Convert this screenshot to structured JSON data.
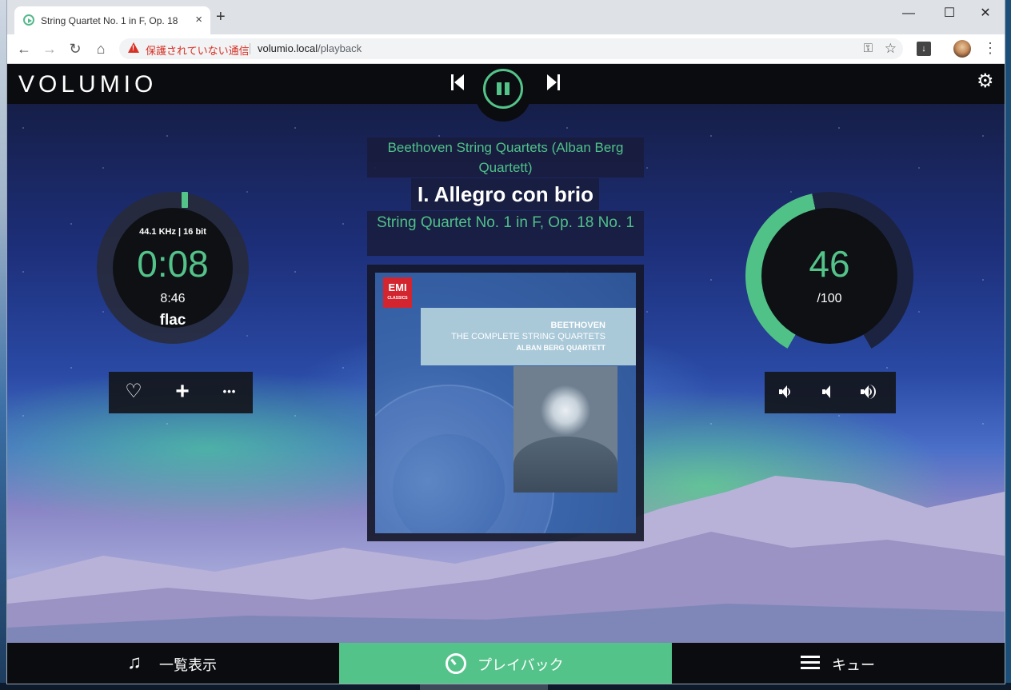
{
  "browser": {
    "tab_title": "String Quartet No. 1 in F, Op. 18",
    "tab_close": "×",
    "new_tab": "+",
    "window_controls": {
      "minimize": "—",
      "maximize": "☐",
      "close": "✕"
    },
    "security_text": "保護されていない通信",
    "url_host": "volumio.local",
    "url_path": "/playback",
    "nav": {
      "back": "←",
      "forward": "→",
      "reload": "↻",
      "home": "⌂"
    },
    "icons": {
      "key": "⚿",
      "star": "☆",
      "menu": "⋮",
      "extension": "↓"
    }
  },
  "app": {
    "logo": "VOLUMIO",
    "settings_icon": "⚙",
    "playback": {
      "sample_rate": "44.1 KHz | 16 bit",
      "elapsed": "0:08",
      "duration": "8:46",
      "format": "flac",
      "progress": 0.015
    },
    "actions": {
      "favorite": "♡",
      "add": "+",
      "more": "•••"
    },
    "album": "Beethoven String Quartets (Alban Berg Quartett)",
    "title": "I. Allegro con brio",
    "track": "String Quartet No. 1 in F, Op. 18 No. 1",
    "album_art": {
      "label_logo": "EMI",
      "label_sub": "CLASSICS",
      "line1": "BEETHOVEN",
      "line2": "THE COMPLETE STRING QUARTETS",
      "line3": "ALBAN BERG QUARTETT"
    },
    "volume": {
      "value": "46",
      "max": "/100"
    },
    "bottom_nav": {
      "browse": "一覧表示",
      "playback": "プレイバック",
      "queue": "キュー"
    }
  },
  "colors": {
    "accent": "#54c38a",
    "bar": "#0b0c0f",
    "warning": "#d93025"
  }
}
